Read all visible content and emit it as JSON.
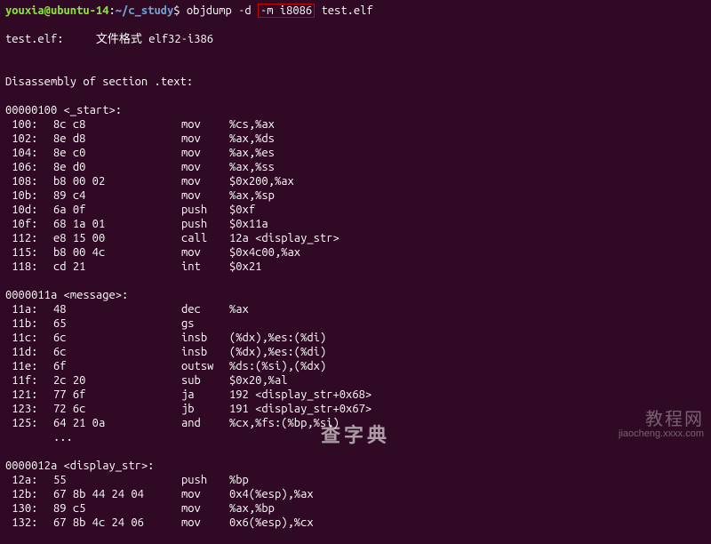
{
  "prompt": {
    "user": "youxia@ubuntu-14",
    "sep": ":",
    "path": "~/c_study",
    "dollar": "$",
    "cmd_pre": "objdump -d ",
    "cmd_boxed": "-m i8086",
    "cmd_post": " test.elf"
  },
  "file_line": "test.elf:     文件格式 elf32-i386",
  "disasm_header": "Disassembly of section .text:",
  "sections": [
    {
      "label": "00000100 <_start>:",
      "rows": [
        {
          "addr": " 100:",
          "bytes": "8c c8",
          "mn": "mov",
          "ops": "%cs,%ax"
        },
        {
          "addr": " 102:",
          "bytes": "8e d8",
          "mn": "mov",
          "ops": "%ax,%ds"
        },
        {
          "addr": " 104:",
          "bytes": "8e c0",
          "mn": "mov",
          "ops": "%ax,%es"
        },
        {
          "addr": " 106:",
          "bytes": "8e d0",
          "mn": "mov",
          "ops": "%ax,%ss"
        },
        {
          "addr": " 108:",
          "bytes": "b8 00 02",
          "mn": "mov",
          "ops": "$0x200,%ax"
        },
        {
          "addr": " 10b:",
          "bytes": "89 c4",
          "mn": "mov",
          "ops": "%ax,%sp"
        },
        {
          "addr": " 10d:",
          "bytes": "6a 0f",
          "mn": "push",
          "ops": "$0xf"
        },
        {
          "addr": " 10f:",
          "bytes": "68 1a 01",
          "mn": "push",
          "ops": "$0x11a"
        },
        {
          "addr": " 112:",
          "bytes": "e8 15 00",
          "mn": "call",
          "ops": "12a <display_str>"
        },
        {
          "addr": " 115:",
          "bytes": "b8 00 4c",
          "mn": "mov",
          "ops": "$0x4c00,%ax"
        },
        {
          "addr": " 118:",
          "bytes": "cd 21",
          "mn": "int",
          "ops": "$0x21"
        }
      ]
    },
    {
      "label": "0000011a <message>:",
      "rows": [
        {
          "addr": " 11a:",
          "bytes": "48",
          "mn": "dec",
          "ops": "%ax"
        },
        {
          "addr": " 11b:",
          "bytes": "65",
          "mn": "gs",
          "ops": ""
        },
        {
          "addr": " 11c:",
          "bytes": "6c",
          "mn": "insb",
          "ops": "(%dx),%es:(%di)"
        },
        {
          "addr": " 11d:",
          "bytes": "6c",
          "mn": "insb",
          "ops": "(%dx),%es:(%di)"
        },
        {
          "addr": " 11e:",
          "bytes": "6f",
          "mn": "outsw",
          "ops": "%ds:(%si),(%dx)"
        },
        {
          "addr": " 11f:",
          "bytes": "2c 20",
          "mn": "sub",
          "ops": "$0x20,%al"
        },
        {
          "addr": " 121:",
          "bytes": "77 6f",
          "mn": "ja",
          "ops": "192 <display_str+0x68>"
        },
        {
          "addr": " 123:",
          "bytes": "72 6c",
          "mn": "jb",
          "ops": "191 <display_str+0x67>"
        },
        {
          "addr": " 125:",
          "bytes": "64 21 0a",
          "mn": "and",
          "ops": "%cx,%fs:(%bp,%si)"
        },
        {
          "addr": "",
          "bytes": "...",
          "mn": "",
          "ops": ""
        }
      ]
    },
    {
      "label": "0000012a <display_str>:",
      "rows": [
        {
          "addr": " 12a:",
          "bytes": "55",
          "mn": "push",
          "ops": "%bp"
        },
        {
          "addr": " 12b:",
          "bytes": "67 8b 44 24 04",
          "mn": "mov",
          "ops": "0x4(%esp),%ax"
        },
        {
          "addr": " 130:",
          "bytes": "89 c5",
          "mn": "mov",
          "ops": "%ax,%bp"
        },
        {
          "addr": " 132:",
          "bytes": "67 8b 4c 24 06",
          "mn": "mov",
          "ops": "0x6(%esp),%cx"
        }
      ]
    }
  ],
  "watermarks": {
    "w1": "教程网",
    "w2": "jiaocheng.xxxx.com",
    "w3": "查字典"
  }
}
